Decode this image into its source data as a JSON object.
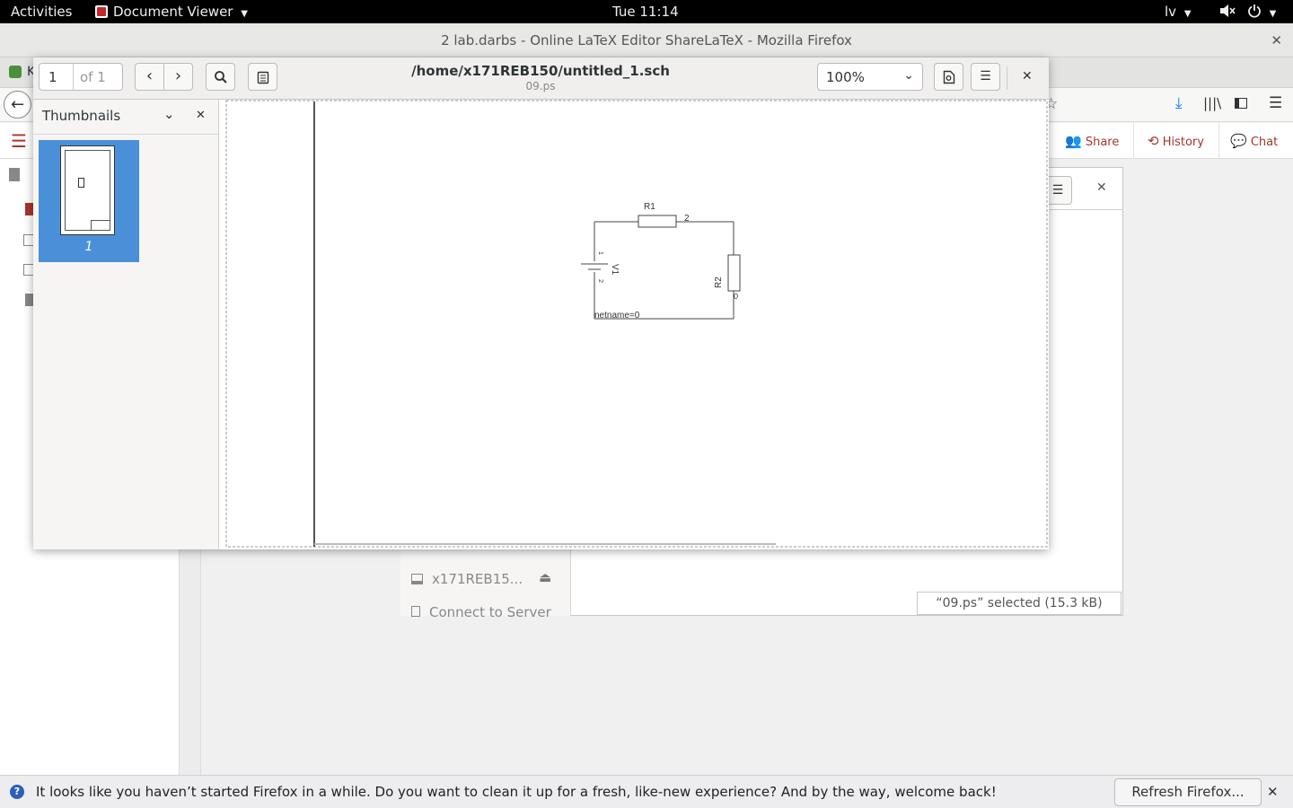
{
  "topbar": {
    "activities": "Activities",
    "app_menu": "Document Viewer",
    "clock": "Tue 11:14",
    "keyboard_layout": "lv"
  },
  "firefox": {
    "window_title": "2 lab.darbs - Online LaTeX Editor ShareLaTeX - Mozilla Firefox",
    "tab_initial": "K"
  },
  "overleaf": {
    "share": "Share",
    "history": "History",
    "chat": "Chat",
    "accent": "#a93529"
  },
  "file_chooser": {
    "sidebar_items": [
      "x171REB15...",
      "Connect to Server"
    ],
    "status": "“09.ps” selected (15.3 kB)"
  },
  "viewer": {
    "page_current": "1",
    "page_total": "of 1",
    "file_path": "/home/x171REB150/untitled_1.sch",
    "file_name": "09.ps",
    "zoom": "100%",
    "sidebar_title": "Thumbnails",
    "thumb_label": "1"
  },
  "schematic": {
    "r1": "R1",
    "r2": "R2",
    "v1": "V1",
    "node2": "2",
    "node0": "0",
    "pin1": "1",
    "pin2": "2",
    "netname": "netname=0"
  },
  "notification": {
    "message": "It looks like you haven’t started Firefox in a while. Do you want to clean it up for a fresh, like-new experience? And by the way, welcome back!",
    "refresh_button": "Refresh Firefox..."
  }
}
